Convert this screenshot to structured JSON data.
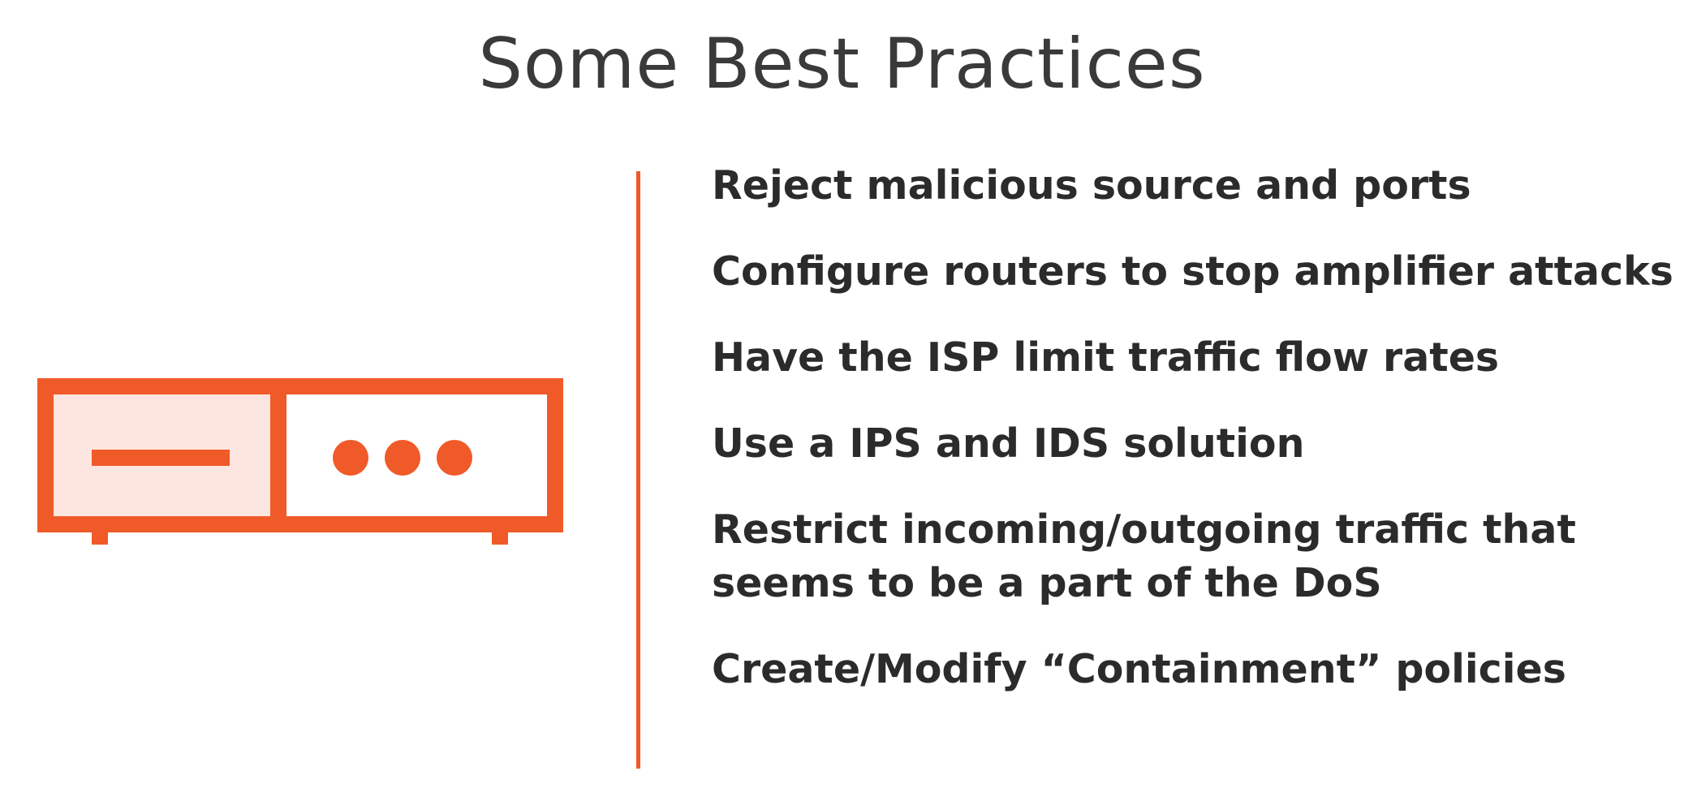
{
  "slide": {
    "title": "Some Best Practices",
    "practices": [
      "Reject malicious source and ports",
      "Configure routers to stop amplifier attacks",
      "Have the ISP limit traffic flow rates",
      "Use a IPS and IDS solution",
      "Restrict incoming/outgoing traffic that\nseems to be a part of the DoS",
      "Create/Modify “Containment” policies"
    ]
  },
  "icon": "router-icon",
  "colors": {
    "accent": "#f05a28",
    "accent_tint": "#fde6df",
    "text": "#2b2b2b",
    "title": "#3a3a3a",
    "background": "#ffffff"
  }
}
